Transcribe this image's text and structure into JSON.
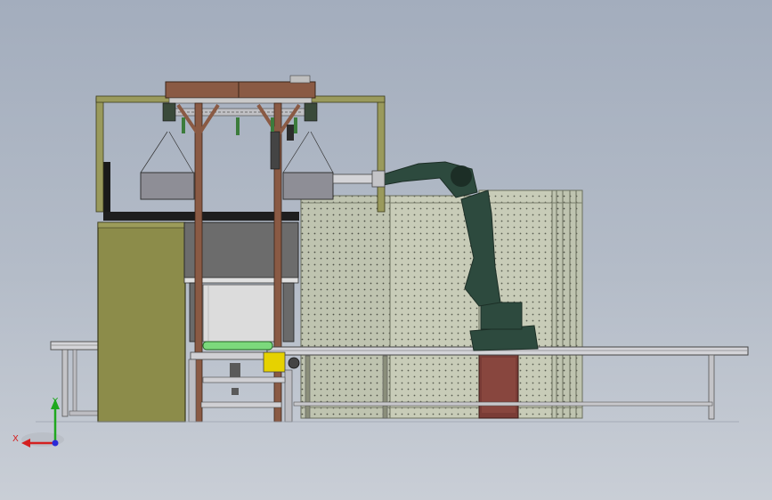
{
  "viewport": {
    "background_top": "#a3adbd",
    "background_bottom": "#c9ced6"
  },
  "triad": {
    "y_label": "Y",
    "x_label": "X",
    "y_color": "#1fa81f",
    "x_color": "#d42020",
    "z_color": "#2a2ad8"
  },
  "colors": {
    "wood": "#8a5a44",
    "wood_dark": "#5a3a2a",
    "olive": "#8c8c4a",
    "olive_dark": "#5c5c2c",
    "frame_olive": "#9a9a5c",
    "panel_grey": "#6e6e6e",
    "box_grey": "#8e8e96",
    "mesh": "#c5cab5",
    "robot": "#2d4a3e",
    "robot_dark": "#1c2e26",
    "conveyor": "#d0d0d4",
    "roller_green": "#7cd97c",
    "yellow": "#e6d200",
    "column_red": "#7a3c36"
  },
  "parts": [
    {
      "id": "conveyor-left",
      "label": "conveyor-left"
    },
    {
      "id": "conveyor-right",
      "label": "conveyor-right"
    },
    {
      "id": "gantry-frame",
      "label": "gantry-frame"
    },
    {
      "id": "mesh-fence",
      "label": "mesh-fence"
    },
    {
      "id": "robot-arm",
      "label": "robot-arm"
    }
  ]
}
